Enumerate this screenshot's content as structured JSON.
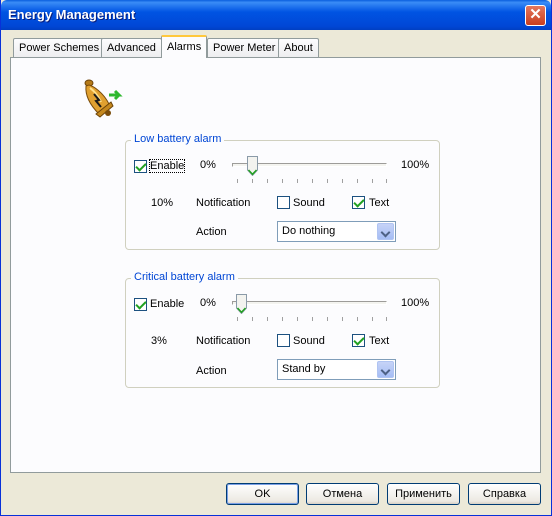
{
  "window": {
    "title": "Energy Management"
  },
  "tabs": [
    "Power Schemes",
    "Advanced",
    "Alarms",
    "Power Meter",
    "About"
  ],
  "active_tab": "Alarms",
  "icons": {
    "alarm": "alarm-bell-icon",
    "close": "close-icon"
  },
  "low_alarm": {
    "title": "Low battery alarm",
    "enable_label": "Enable",
    "enabled": true,
    "min_label": "0%",
    "max_label": "100%",
    "level_value": "10%",
    "level": 0.1,
    "notification_label": "Notification",
    "sound_label": "Sound",
    "sound_checked": false,
    "text_label": "Text",
    "text_checked": true,
    "action_label": "Action",
    "action_value": "Do nothing"
  },
  "critical_alarm": {
    "title": "Critical battery alarm",
    "enable_label": "Enable",
    "enabled": true,
    "min_label": "0%",
    "max_label": "100%",
    "level_value": "3%",
    "level": 0.03,
    "notification_label": "Notification",
    "sound_label": "Sound",
    "sound_checked": false,
    "text_label": "Text",
    "text_checked": true,
    "action_label": "Action",
    "action_value": "Stand by"
  },
  "buttons": {
    "ok": "OK",
    "cancel": "Отмена",
    "apply": "Применить",
    "help": "Справка"
  },
  "colors": {
    "title_bar": "#0054e3",
    "group_title": "#0046d5",
    "check": "#21a121"
  }
}
